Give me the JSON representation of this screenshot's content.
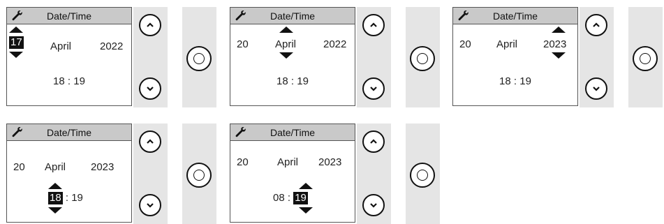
{
  "colors": {
    "screen_bg": "#ffffff",
    "title_bar": "#c9c9c9",
    "panel": "#e5e5e5",
    "highlight": "#111111"
  },
  "steps": [
    {
      "title": "Date/Time",
      "day": "17",
      "month": "April",
      "year": "2022",
      "hour": "18",
      "minute": "19",
      "selected_field": "day"
    },
    {
      "title": "Date/Time",
      "day": "20",
      "month": "April",
      "year": "2022",
      "hour": "18",
      "minute": "19",
      "selected_field": "month"
    },
    {
      "title": "Date/Time",
      "day": "20",
      "month": "April",
      "year": "2023",
      "hour": "18",
      "minute": "19",
      "selected_field": "year"
    },
    {
      "title": "Date/Time",
      "day": "20",
      "month": "April",
      "year": "2023",
      "hour": "18",
      "minute": "19",
      "selected_field": "hour"
    },
    {
      "title": "Date/Time",
      "day": "20",
      "month": "April",
      "year": "2023",
      "hour": "08",
      "minute": "19",
      "selected_field": "minute"
    }
  ],
  "time_separator": ":",
  "icons": {
    "settings": "wrench-icon",
    "up": "chevron-up-icon",
    "down": "chevron-down-icon",
    "ok": "ok-circle-icon"
  }
}
